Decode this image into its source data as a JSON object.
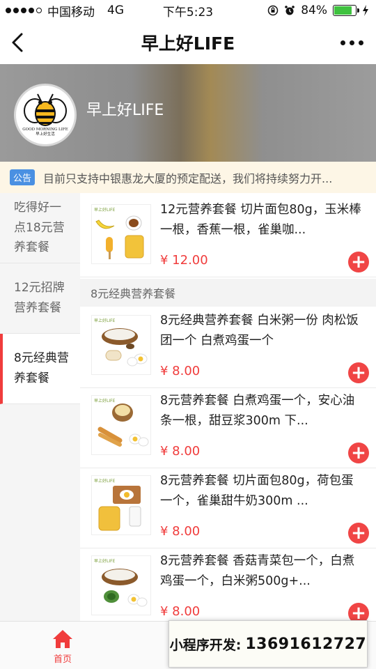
{
  "status_bar": {
    "carrier": "中国移动",
    "network": "4G",
    "time": "下午5:23",
    "battery_percent": "84%",
    "battery_level": 0.84
  },
  "nav": {
    "title": "早上好LIFE"
  },
  "shop": {
    "name": "早上好LIFE",
    "logo_caption_en": "GOOD MORNING LIFE",
    "logo_caption_cn": "早上好生活"
  },
  "notice": {
    "tag": "公告",
    "text": "目前只支持中银惠龙大厦的预定配送，我们将持续努力开..."
  },
  "categories": [
    {
      "label": "吃得好一点18元营养套餐",
      "active": false
    },
    {
      "label": "12元招牌营养套餐",
      "active": false
    },
    {
      "label": "8元经典营养套餐",
      "active": true
    }
  ],
  "items": [
    {
      "title": "12元营养套餐 切片面包80g，玉米棒一根，香蕉一根，雀巢咖...",
      "price": "¥ 12.00",
      "brand": "早上好LIFE",
      "icon": "banana-coffee-corn-bread-image"
    },
    {
      "title": "8元经典营养套餐 白米粥一份 肉松饭团一个 白煮鸡蛋一个",
      "price": "¥ 8.00",
      "brand": "早上好LIFE",
      "icon": "porridge-riceball-egg-image"
    },
    {
      "title": "8元营养套餐 白煮鸡蛋一个，安心油条一根，甜豆浆300m 下...",
      "price": "¥ 8.00",
      "brand": "早上好LIFE",
      "icon": "soymilk-youtiao-egg-image"
    },
    {
      "title": "8元营养套餐 切片面包80g，荷包蛋一个，雀巢甜牛奶300m ...",
      "price": "¥ 8.00",
      "brand": "早上好LIFE",
      "icon": "bread-egg-milk-image"
    },
    {
      "title": "8元营养套餐 香菇青菜包一个，白煮鸡蛋一个，白米粥500g+...",
      "price": "¥ 8.00",
      "brand": "早上好LIFE",
      "icon": "porridge-bun-egg-image"
    }
  ],
  "section_header": "8元经典营养套餐",
  "tabbar": {
    "home_label": "首页"
  },
  "overlay": {
    "label": "小程序开发:",
    "phone": "13691612727"
  },
  "colors": {
    "accent": "#f03c3c",
    "notice_tag": "#4a90e2",
    "notice_bg": "#fdf6e6"
  }
}
